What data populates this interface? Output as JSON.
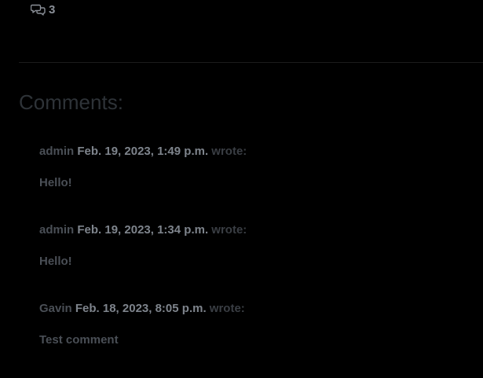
{
  "post": {
    "comment_count": "3",
    "comment_icon": "chat-bubbles-icon"
  },
  "comments_section": {
    "heading": "Comments:",
    "wrote_label": "wrote:",
    "items": [
      {
        "author": "admin",
        "date": "Feb. 19, 2023, 1:49 p.m.",
        "body": "Hello!"
      },
      {
        "author": "admin",
        "date": "Feb. 19, 2023, 1:34 p.m.",
        "body": "Hello!"
      },
      {
        "author": "Gavin",
        "date": "Feb. 18, 2023, 8:05 p.m.",
        "body": "Test comment"
      }
    ]
  }
}
